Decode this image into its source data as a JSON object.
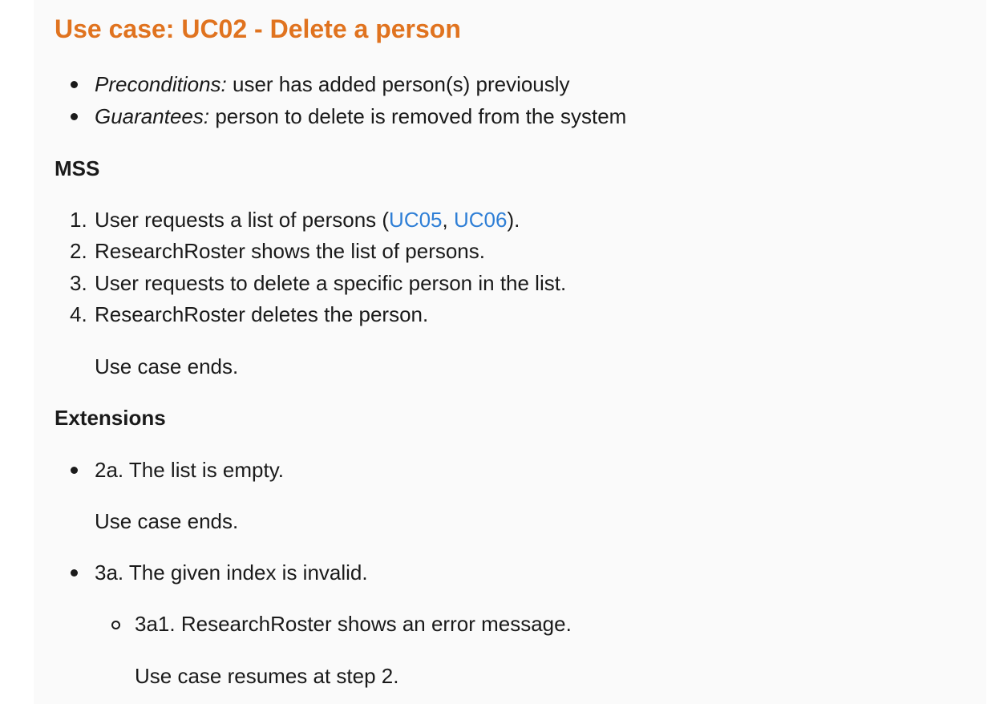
{
  "title": "Use case: UC02 - Delete a person",
  "preconditions": {
    "label": "Preconditions:",
    "text": " user has added person(s) previously"
  },
  "guarantees": {
    "label": "Guarantees:",
    "text": " person to delete is removed from the system"
  },
  "mss": {
    "heading": "MSS",
    "steps": [
      {
        "num": "1.",
        "text_before": "User requests a list of persons (",
        "link1": "UC05",
        "sep": ", ",
        "link2": "UC06",
        "text_after": ")."
      },
      {
        "num": "2.",
        "text": "ResearchRoster shows the list of persons."
      },
      {
        "num": "3.",
        "text": "User requests to delete a specific person in the list."
      },
      {
        "num": "4.",
        "text": "ResearchRoster deletes the person."
      }
    ],
    "ending": "Use case ends."
  },
  "extensions": {
    "heading": "Extensions",
    "e2a": {
      "text": "2a. The list is empty.",
      "ending": "Use case ends."
    },
    "e3a": {
      "text": "3a. The given index is invalid.",
      "sub": {
        "text": "3a1. ResearchRoster shows an error message.",
        "ending": "Use case resumes at step 2."
      }
    }
  },
  "colors": {
    "title": "#e0731f",
    "link": "#2f7fd6",
    "panel": "#fafafa"
  }
}
